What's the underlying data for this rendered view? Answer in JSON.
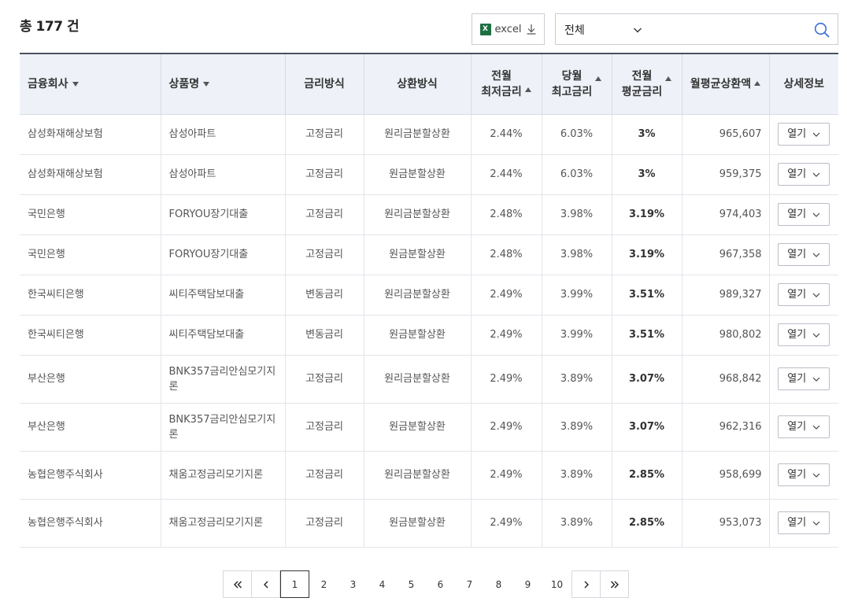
{
  "total_label": "총 177 건",
  "excel_label": "excel",
  "filter": {
    "selected": "전체"
  },
  "headers": {
    "company": "금융회사",
    "product": "상품명",
    "rate_type": "금리방식",
    "repay_type": "상환방식",
    "prev_min_l1": "전월",
    "prev_min_l2": "최저금리",
    "cur_max_l1": "당월",
    "cur_max_l2": "최고금리",
    "prev_avg_l1": "전월",
    "prev_avg_l2": "평균금리",
    "monthly": "월평균상환액",
    "detail": "상세정보"
  },
  "open_label": "열기",
  "rows": [
    {
      "company": "삼성화재해상보험",
      "product": "삼성아파트",
      "rate_type": "고정금리",
      "repay_type": "원리금분할상환",
      "prev_min": "2.44%",
      "cur_max": "6.03%",
      "prev_avg": "3%",
      "monthly": "965,607"
    },
    {
      "company": "삼성화재해상보험",
      "product": "삼성아파트",
      "rate_type": "고정금리",
      "repay_type": "원금분할상환",
      "prev_min": "2.44%",
      "cur_max": "6.03%",
      "prev_avg": "3%",
      "monthly": "959,375"
    },
    {
      "company": "국민은행",
      "product": "FORYOU장기대출",
      "rate_type": "고정금리",
      "repay_type": "원리금분할상환",
      "prev_min": "2.48%",
      "cur_max": "3.98%",
      "prev_avg": "3.19%",
      "monthly": "974,403"
    },
    {
      "company": "국민은행",
      "product": "FORYOU장기대출",
      "rate_type": "고정금리",
      "repay_type": "원금분할상환",
      "prev_min": "2.48%",
      "cur_max": "3.98%",
      "prev_avg": "3.19%",
      "monthly": "967,358"
    },
    {
      "company": "한국씨티은행",
      "product": "씨티주택담보대출",
      "rate_type": "변동금리",
      "repay_type": "원리금분할상환",
      "prev_min": "2.49%",
      "cur_max": "3.99%",
      "prev_avg": "3.51%",
      "monthly": "989,327"
    },
    {
      "company": "한국씨티은행",
      "product": "씨티주택담보대출",
      "rate_type": "변동금리",
      "repay_type": "원금분할상환",
      "prev_min": "2.49%",
      "cur_max": "3.99%",
      "prev_avg": "3.51%",
      "monthly": "980,802"
    },
    {
      "company": "부산은행",
      "product": "BNK357금리안심모기지론",
      "rate_type": "고정금리",
      "repay_type": "원리금분할상환",
      "prev_min": "2.49%",
      "cur_max": "3.89%",
      "prev_avg": "3.07%",
      "monthly": "968,842"
    },
    {
      "company": "부산은행",
      "product": "BNK357금리안심모기지론",
      "rate_type": "고정금리",
      "repay_type": "원금분할상환",
      "prev_min": "2.49%",
      "cur_max": "3.89%",
      "prev_avg": "3.07%",
      "monthly": "962,316"
    },
    {
      "company": "농협은행주식회사",
      "product": "채움고정금리모기지론",
      "rate_type": "고정금리",
      "repay_type": "원리금분할상환",
      "prev_min": "2.49%",
      "cur_max": "3.89%",
      "prev_avg": "2.85%",
      "monthly": "958,699"
    },
    {
      "company": "농협은행주식회사",
      "product": "채움고정금리모기지론",
      "rate_type": "고정금리",
      "repay_type": "원금분할상환",
      "prev_min": "2.49%",
      "cur_max": "3.89%",
      "prev_avg": "2.85%",
      "monthly": "953,073"
    }
  ],
  "pagination": {
    "pages": [
      "1",
      "2",
      "3",
      "4",
      "5",
      "6",
      "7",
      "8",
      "9",
      "10"
    ],
    "current": "1"
  }
}
